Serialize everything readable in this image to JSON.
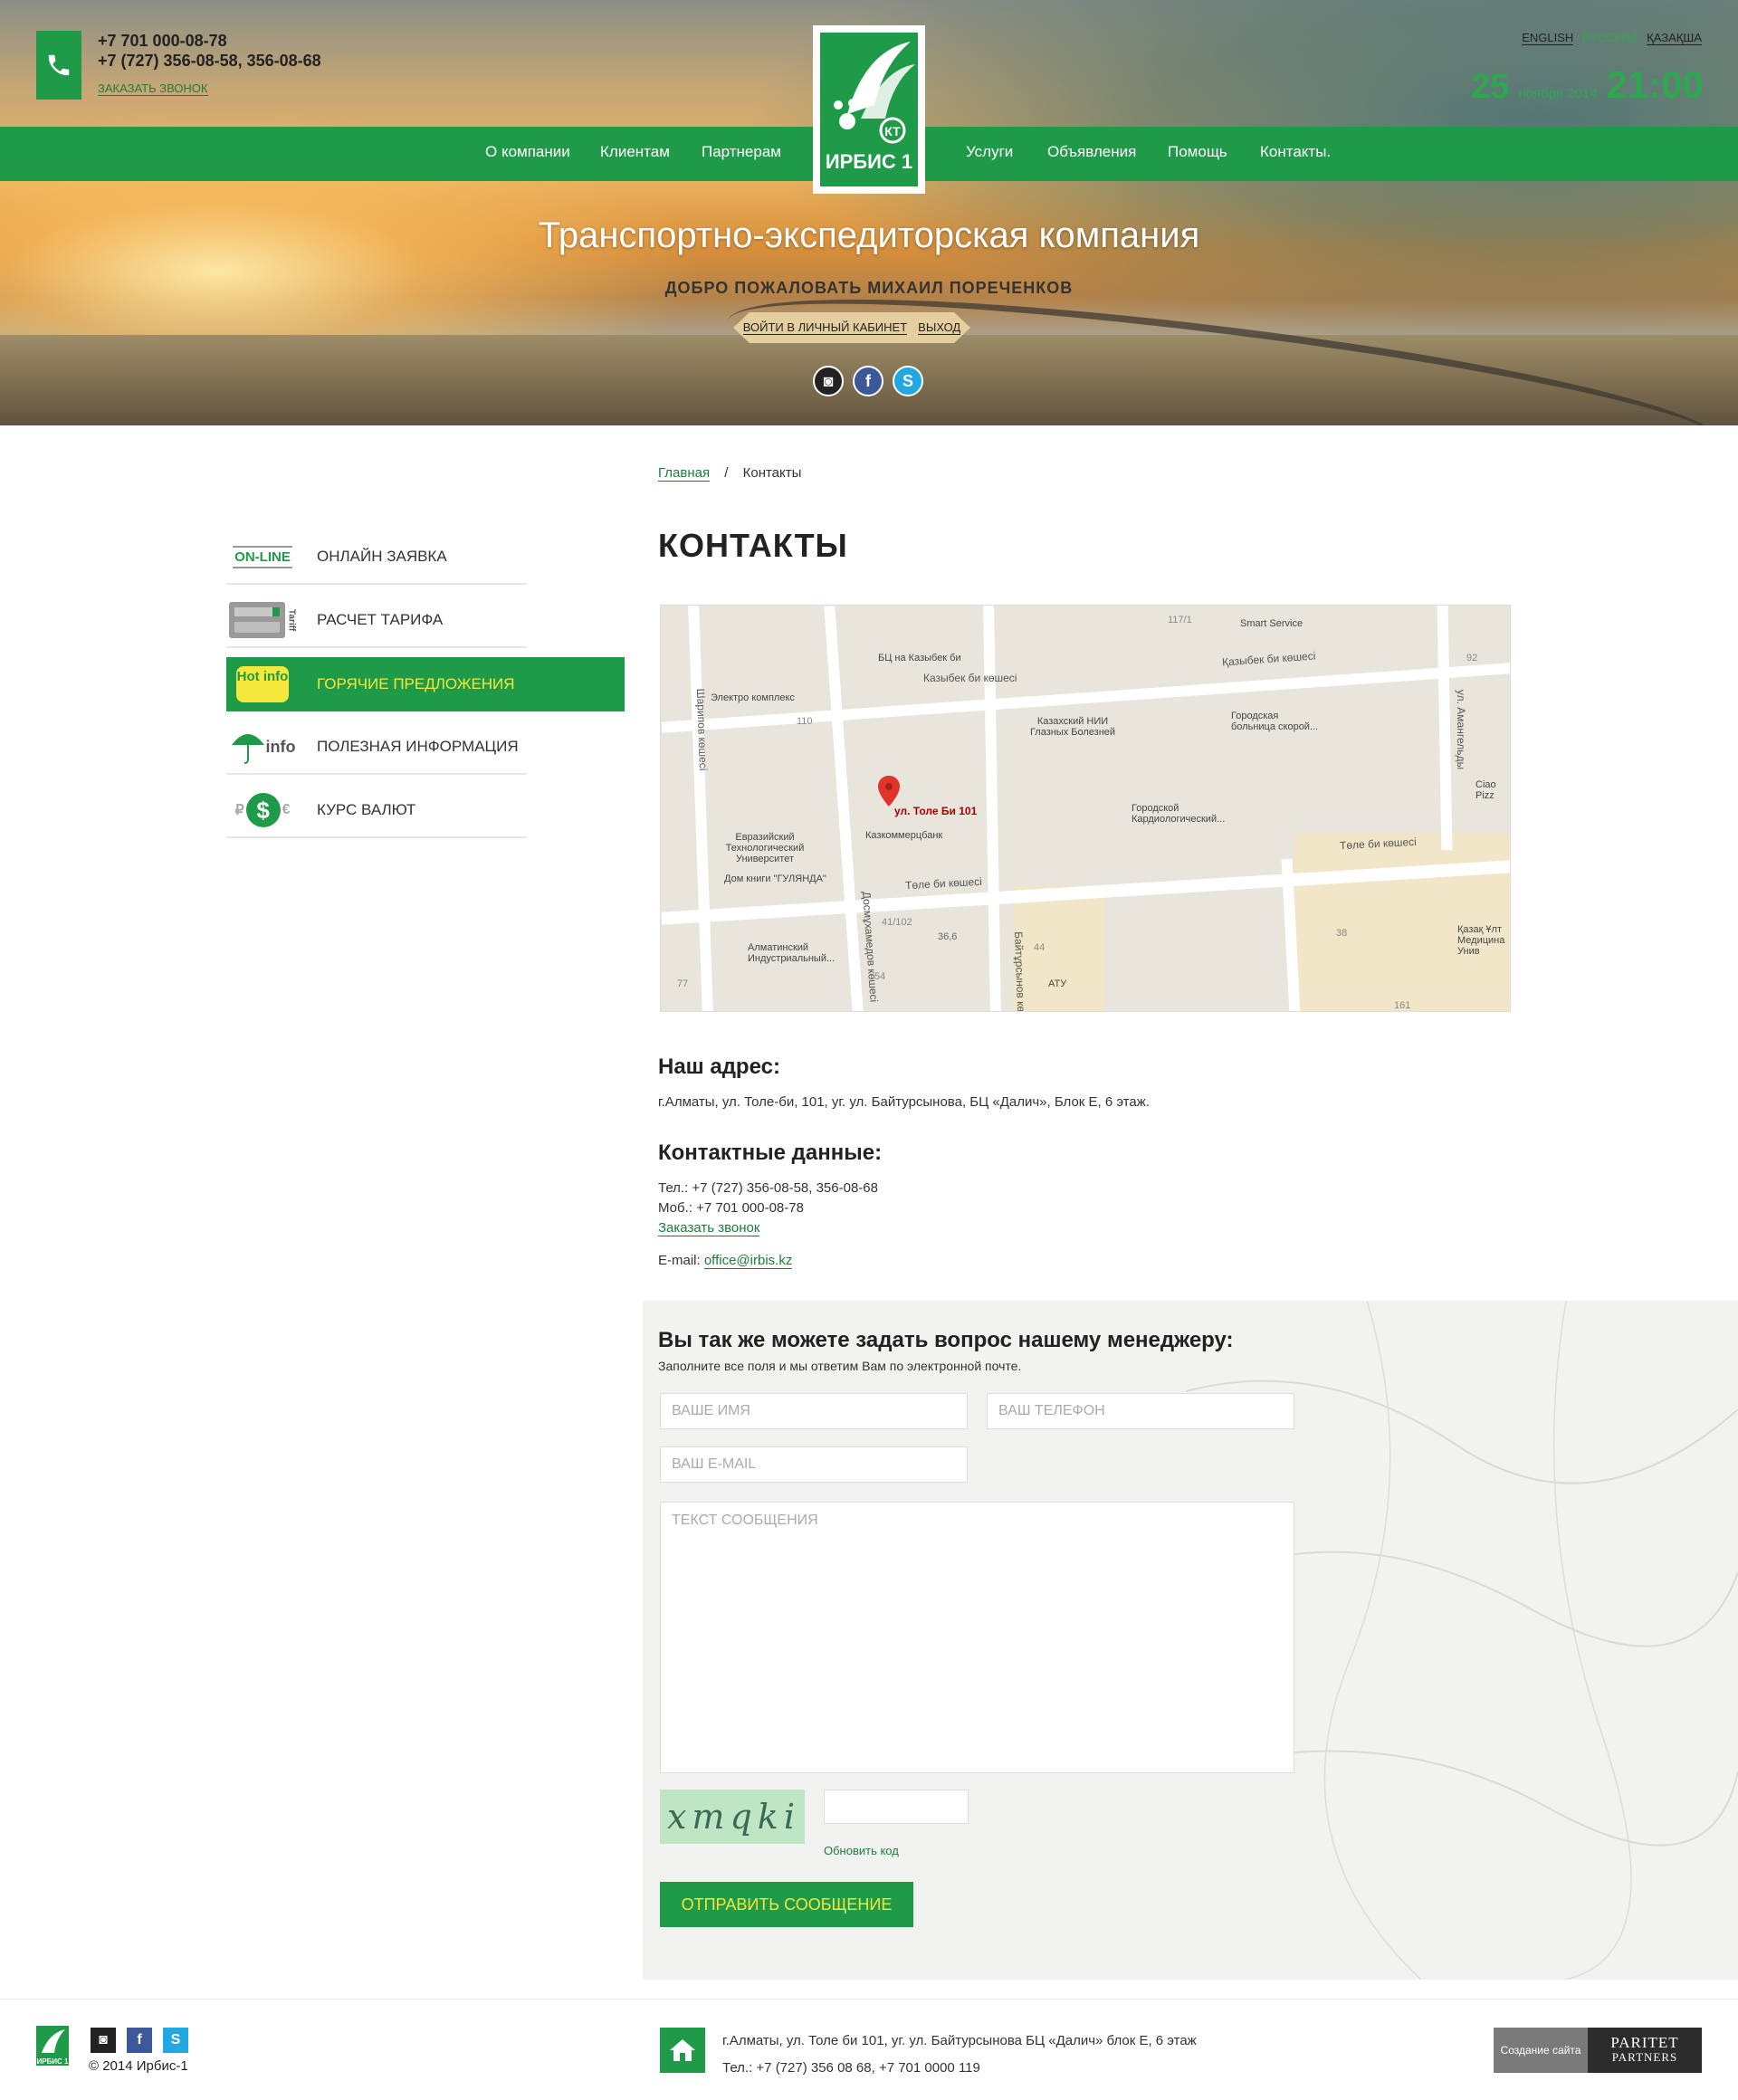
{
  "header": {
    "phone1": "+7 701 000-08-78",
    "phone2": "+7 (727) 356-08-58, 356-08-68",
    "callback": "ЗАКАЗАТЬ ЗВОНОК",
    "langs": [
      "ENGLISH",
      "РУССКИЙ",
      "ҚАЗАҚША"
    ],
    "date_day": "25",
    "date_month": "ноября 2014",
    "time": "21:00",
    "logo_text": "ИРБИС 1",
    "logo_badge": "КТ",
    "tagline": "Транспортно-экспедиторская компания",
    "welcome": "ДОБРО ПОЖАЛОВАТЬ МИХАИЛ ПОРЕЧЕНКОВ",
    "cabinet_link": "ВОЙТИ В ЛИЧНЫЙ КАБИНЕТ",
    "logout_link": "ВЫХОД"
  },
  "nav": [
    "О компании",
    "Клиентам",
    "Партнерам",
    "Услуги",
    "Объявления",
    "Помощь",
    "Контакты."
  ],
  "breadcrumb": {
    "home": "Главная",
    "sep": "/",
    "current": "Контакты"
  },
  "sidebar": [
    {
      "icon": "ON-LINE",
      "label": "ОНЛАЙН ЗАЯВКА"
    },
    {
      "icon": "Tariff",
      "label": "РАСЧЕТ ТАРИФА"
    },
    {
      "icon": "Hot info",
      "label": "ГОРЯЧИЕ ПРЕДЛОЖЕНИЯ"
    },
    {
      "icon": "info",
      "label": "ПОЛЕЗНАЯ ИНФОРМАЦИЯ"
    },
    {
      "icon": "₽$€",
      "label": "КУРС ВАЛЮТ"
    }
  ],
  "page_title": "КОНТАКТЫ",
  "map": {
    "pin_label": "ул. Толе Би 101",
    "labels": [
      "Казыбек би көшесі",
      "Қазыбек би көшесі",
      "Төле би көшесі",
      "Төле би көшесі",
      "Шарипов көшесі",
      "Досмұхамедов көшесі",
      "Байтұрсынов көшесі",
      "ул. Амангельды",
      "БЦ на Казыбек би",
      "Электро комплекс",
      "Казахский НИИ Глазных Болезней",
      "Городская больница скорой...",
      "Городской Кардиологический...",
      "Казкоммерцбанк",
      "Евразийский Технологический Университет",
      "Дом книги \"ГУЛЯНДА\"",
      "Алматинский Индустриальный...",
      "АТУ",
      "Smart Service",
      "Ciao Pizz",
      "Қазақ Ұлт Медицина Унив",
      "117/1",
      "110",
      "92",
      "41/102",
      "36,6",
      "44",
      "54",
      "77",
      "38",
      "161"
    ]
  },
  "address": {
    "heading": "Наш адрес:",
    "text": "г.Алматы, ул. Толе-би, 101, уг. ул. Байтурсынова, БЦ «Далич», Блок Е, 6 этаж."
  },
  "contact_data": {
    "heading": "Контактные данные:",
    "tel": "Тел.: +7 (727) 356-08-58, 356-08-68",
    "mob": "Моб.: +7 701 000-08-78",
    "callback": "Заказать звонок",
    "email_label": "E-mail:",
    "email": "office@irbis.kz"
  },
  "form": {
    "title": "Вы так же можете задать вопрос нашему менеджеру:",
    "subtitle": "Заполните все поля и мы ответим Вам по электронной почте.",
    "name_placeholder": "ВАШЕ ИМЯ",
    "phone_placeholder": "ВАШ ТЕЛЕФОН",
    "email_placeholder": "ВАШ E-MAIL",
    "message_placeholder": "ТЕКСТ СООБЩЕНИЯ",
    "captcha_text": "xmqki",
    "refresh": "Обновить код",
    "submit": "ОТПРАВИТЬ СООБЩЕНИЕ"
  },
  "footer": {
    "logo_text": "ИРБИС 1",
    "copyright": "© 2014  Ирбис-1",
    "address": "г.Алматы, ул. Толе би 101, уг. ул. Байтурсынова БЦ «Далич» блок Е, 6 этаж",
    "phones": "Тел.: +7 (727) 356 08 68, +7 701 0000 119",
    "creator_label": "Создание сайта",
    "creator_brand1": "PARITET",
    "creator_brand2": "PARTNERS"
  },
  "colors": {
    "brand_green": "#1e9a48",
    "accent_yellow": "#f6e83a",
    "date_green": "#2ea84f"
  }
}
